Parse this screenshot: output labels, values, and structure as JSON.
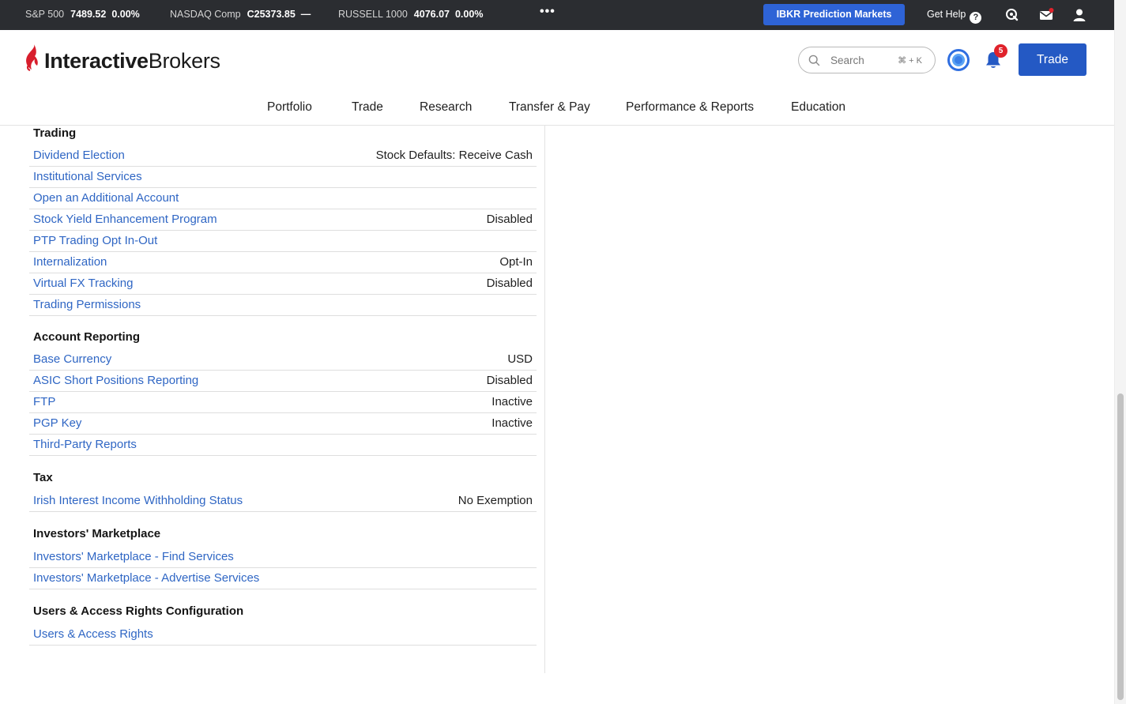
{
  "ticker": {
    "items": [
      {
        "name": "S&P 500",
        "value": "7489.52",
        "change": "0.00%"
      },
      {
        "name": "NASDAQ Comp",
        "value": "C25373.85",
        "change": "—"
      },
      {
        "name": "RUSSELL 1000",
        "value": "4076.07",
        "change": "0.00%"
      }
    ],
    "more_label": "•••",
    "prediction_markets_label": "IBKR Prediction Markets",
    "get_help_label": "Get Help",
    "get_help_icon": "?"
  },
  "header": {
    "logo_bold": "Interactive",
    "logo_regular": "Brokers",
    "search_placeholder": "Search",
    "search_shortcut": "⌘ + K",
    "notification_count": "5",
    "trade_label": "Trade",
    "brand_color": "#2459c4",
    "accent_red": "#d81e2c"
  },
  "nav": {
    "items": [
      "Portfolio",
      "Trade",
      "Research",
      "Transfer & Pay",
      "Performance & Reports",
      "Education"
    ]
  },
  "sections": {
    "trading": {
      "title": "Trading",
      "rows": [
        {
          "label": "Dividend Election",
          "value": "Stock Defaults: Receive Cash"
        },
        {
          "label": "Institutional Services",
          "value": ""
        },
        {
          "label": "Open an Additional Account",
          "value": ""
        },
        {
          "label": "Stock Yield Enhancement Program",
          "value": "Disabled"
        },
        {
          "label": "PTP Trading Opt In-Out",
          "value": ""
        },
        {
          "label": "Internalization",
          "value": "Opt-In"
        },
        {
          "label": "Virtual FX Tracking",
          "value": "Disabled"
        },
        {
          "label": "Trading Permissions",
          "value": ""
        }
      ]
    },
    "reporting": {
      "title": "Account Reporting",
      "rows": [
        {
          "label": "Base Currency",
          "value": "USD"
        },
        {
          "label": "ASIC Short Positions Reporting",
          "value": "Disabled"
        },
        {
          "label": "FTP",
          "value": "Inactive"
        },
        {
          "label": "PGP Key",
          "value": "Inactive"
        },
        {
          "label": "Third-Party Reports",
          "value": ""
        }
      ]
    },
    "tax": {
      "title": "Tax",
      "rows": [
        {
          "label": "Irish Interest Income Withholding Status",
          "value": "No Exemption"
        }
      ]
    },
    "marketplace": {
      "title": "Investors' Marketplace",
      "rows": [
        {
          "label": "Investors' Marketplace - Find Services",
          "value": ""
        },
        {
          "label": "Investors' Marketplace - Advertise Services",
          "value": ""
        }
      ]
    },
    "users": {
      "title": "Users & Access Rights Configuration",
      "rows": [
        {
          "label": "Users & Access Rights",
          "value": ""
        }
      ]
    }
  }
}
